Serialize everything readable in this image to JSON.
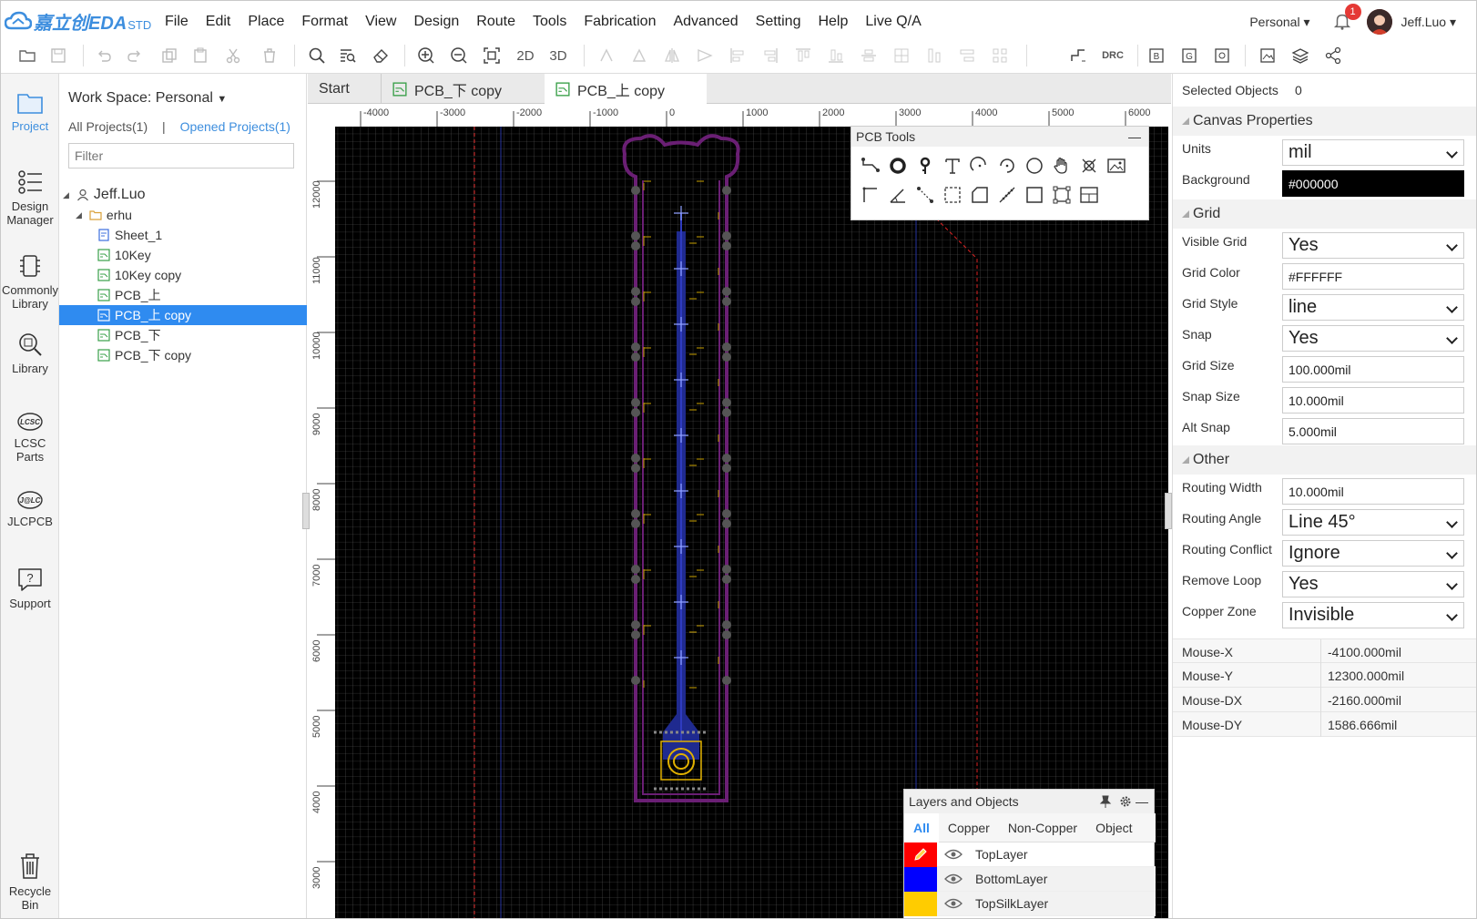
{
  "app": {
    "logo_text": "嘉立创EDA",
    "logo_suffix": "STD",
    "brand_color": "#3d8ede"
  },
  "menu": [
    "File",
    "Edit",
    "Place",
    "Format",
    "View",
    "Design",
    "Route",
    "Tools",
    "Fabrication",
    "Advanced",
    "Setting",
    "Help",
    "Live Q/A"
  ],
  "user": {
    "workspace": "Personal",
    "notifications": "1",
    "name": "Jeff.Luo"
  },
  "toolbar": {
    "btn_2d": "2D",
    "btn_3d": "3D",
    "btn_drc": "DRC",
    "icons": [
      "folder-open-icon",
      "save-icon",
      "undo-icon",
      "redo-icon",
      "copy-icon",
      "paste-icon",
      "cut-icon",
      "delete-icon",
      "search-icon",
      "find-icon",
      "eraser-icon",
      "zoom-in-icon",
      "zoom-out-icon",
      "fit-icon",
      "rotate-left-icon",
      "rotate-right-icon",
      "flip-icon",
      "align-left-icon",
      "align-top-icon",
      "align-bottom-icon",
      "distribute-icon",
      "route-icon",
      "bom-icon",
      "gerber-icon",
      "pick-place-icon",
      "image-export-icon",
      "layers-icon",
      "share-icon"
    ]
  },
  "rail": [
    {
      "label": "Project"
    },
    {
      "label": "Design Manager"
    },
    {
      "label": "Commonly Library"
    },
    {
      "label": "Library"
    },
    {
      "label": "LCSC Parts"
    },
    {
      "label": "JLCPCB"
    },
    {
      "label": "Support"
    },
    {
      "label": "Recycle Bin"
    }
  ],
  "project": {
    "workspace": "Work Space: Personal",
    "all_projects": "All Projects(1)",
    "separator": "|",
    "opened_projects": "Opened Projects(1)",
    "filter_placeholder": "Filter",
    "owner": "Jeff.Luo",
    "folder": "erhu",
    "items": [
      "Sheet_1",
      "10Key",
      "10Key copy",
      "PCB_上",
      "PCB_上 copy",
      "PCB_下",
      "PCB_下 copy"
    ],
    "selected": "PCB_上 copy"
  },
  "tabs": [
    "Start",
    "PCB_下 copy",
    "PCB_上 copy"
  ],
  "ruler": {
    "h": [
      "-4000",
      "-3000",
      "-2000",
      "-1000",
      "0",
      "1000",
      "2000",
      "3000",
      "4000",
      "5000",
      "6000"
    ],
    "v": [
      "12000",
      "11000",
      "10000",
      "9000",
      "8000",
      "7000",
      "6000",
      "5000",
      "4000",
      "3000"
    ]
  },
  "pcb_tools": {
    "title": "PCB Tools",
    "minimize": "—"
  },
  "layers": {
    "title": "Layers and Objects",
    "tabs": [
      "All",
      "Copper",
      "Non-Copper",
      "Object"
    ],
    "rows": [
      {
        "name": "TopLayer",
        "color": "#ff0000"
      },
      {
        "name": "BottomLayer",
        "color": "#0000ff"
      },
      {
        "name": "TopSilkLayer",
        "color": "#ffcc00"
      }
    ]
  },
  "props": {
    "selected_label": "Selected Objects",
    "selected_count": "0",
    "canvas_section": "Canvas Properties",
    "units_label": "Units",
    "units": "mil",
    "bg_label": "Background",
    "bg": "#000000",
    "grid_section": "Grid",
    "visible_grid_label": "Visible Grid",
    "visible_grid": "Yes",
    "grid_color_label": "Grid Color",
    "grid_color": "#FFFFFF",
    "grid_style_label": "Grid Style",
    "grid_style": "line",
    "snap_label": "Snap",
    "snap": "Yes",
    "grid_size_label": "Grid Size",
    "grid_size": "100.000mil",
    "snap_size_label": "Snap Size",
    "snap_size": "10.000mil",
    "alt_snap_label": "Alt Snap",
    "alt_snap": "5.000mil",
    "other_section": "Other",
    "routing_width_label": "Routing Width",
    "routing_width": "10.000mil",
    "routing_angle_label": "Routing Angle",
    "routing_angle": "Line 45°",
    "routing_conflict_label": "Routing Conflict",
    "routing_conflict": "Ignore",
    "remove_loop_label": "Remove Loop",
    "remove_loop": "Yes",
    "copper_zone_label": "Copper Zone",
    "copper_zone": "Invisible"
  },
  "mouse": [
    {
      "k": "Mouse-X",
      "v": "-4100.000mil"
    },
    {
      "k": "Mouse-Y",
      "v": "12300.000mil"
    },
    {
      "k": "Mouse-DX",
      "v": "-2160.000mil"
    },
    {
      "k": "Mouse-DY",
      "v": "1586.666mil"
    }
  ]
}
